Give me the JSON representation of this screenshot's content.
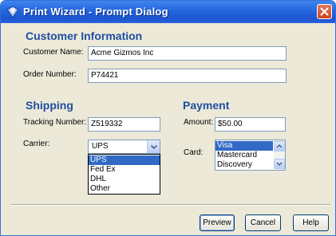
{
  "window": {
    "title": "Print Wizard - Prompt Dialog",
    "accent_color": "#2466de",
    "close_color": "#d0431f"
  },
  "customer": {
    "heading": "Customer Information",
    "name_label": "Customer Name:",
    "name_value": "Acme Gizmos Inc",
    "order_label": "Order Number:",
    "order_value": "P74421"
  },
  "shipping": {
    "heading": "Shipping",
    "tracking_label": "Tracking Number:",
    "tracking_value": "Z519332",
    "carrier_label": "Carrier:",
    "carrier_selected": "UPS",
    "carrier_options": [
      "UPS",
      "Fed Ex",
      "DHL",
      "Other"
    ]
  },
  "payment": {
    "heading": "Payment",
    "amount_label": "Amount:",
    "amount_value": "$50.00",
    "card_label": "Card:",
    "card_options": [
      "Visa",
      "Mastercard",
      "Discovery"
    ],
    "card_selected": "Visa"
  },
  "buttons": {
    "preview": "Preview",
    "cancel": "Cancel",
    "help": "Help"
  }
}
